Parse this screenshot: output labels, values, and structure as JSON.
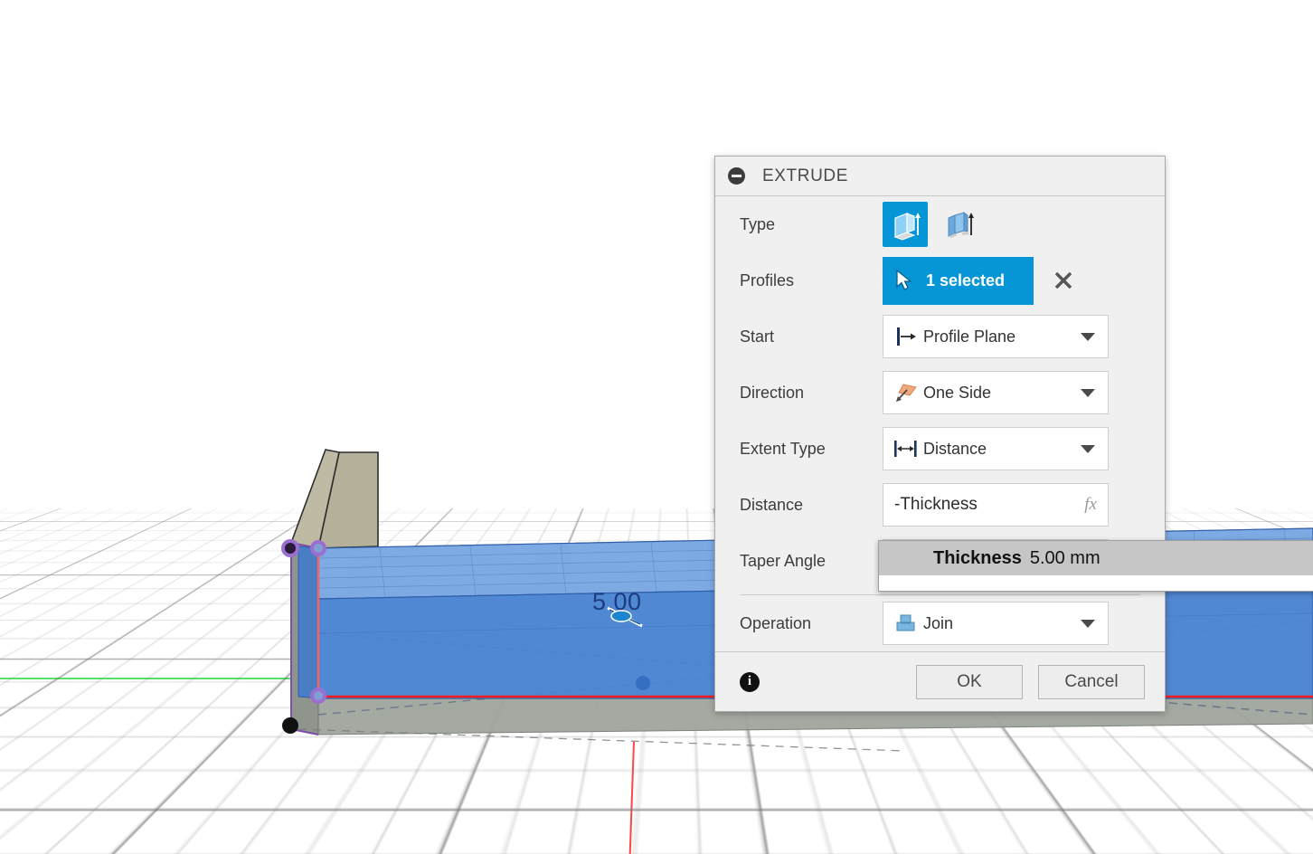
{
  "viewport": {
    "name": "3d-viewport",
    "dimension_label": "5.00",
    "axes": {
      "x_color": "#ff2f2f",
      "y_color": "#55e06a"
    },
    "body_color": "#b5b09a",
    "preview_color": "#4a86d8",
    "sketch_point_color": "#8a55c0"
  },
  "dialog": {
    "title": "EXTRUDE",
    "collapse_icon": "minus-circle-icon",
    "rows": {
      "type": {
        "label": "Type",
        "options": [
          {
            "name": "extrude-solid-icon",
            "selected": true
          },
          {
            "name": "extrude-thin-icon",
            "selected": false
          }
        ]
      },
      "profiles": {
        "label": "Profiles",
        "value": "1 selected",
        "cursor_icon": "pointer-arrow-icon",
        "clear_icon": "close-x-icon",
        "accent": "#0696d7"
      },
      "start": {
        "label": "Start",
        "value": "Profile Plane",
        "icon": "profile-plane-icon"
      },
      "direction": {
        "label": "Direction",
        "value": "One Side",
        "icon": "one-side-icon"
      },
      "extent_type": {
        "label": "Extent Type",
        "value": "Distance",
        "icon": "distance-arrow-icon"
      },
      "distance": {
        "label": "Distance",
        "value": "-Thickness",
        "fx_label": "fx"
      },
      "taper_angle": {
        "label": "Taper Angle",
        "value": ""
      },
      "operation": {
        "label": "Operation",
        "value": "Join",
        "icon": "join-icon"
      }
    },
    "footer": {
      "info_icon": "info-icon",
      "ok_label": "OK",
      "cancel_label": "Cancel"
    }
  },
  "param_popup": {
    "items": [
      {
        "name": "Thickness",
        "value": "5.00 mm",
        "highlighted": true
      }
    ]
  }
}
